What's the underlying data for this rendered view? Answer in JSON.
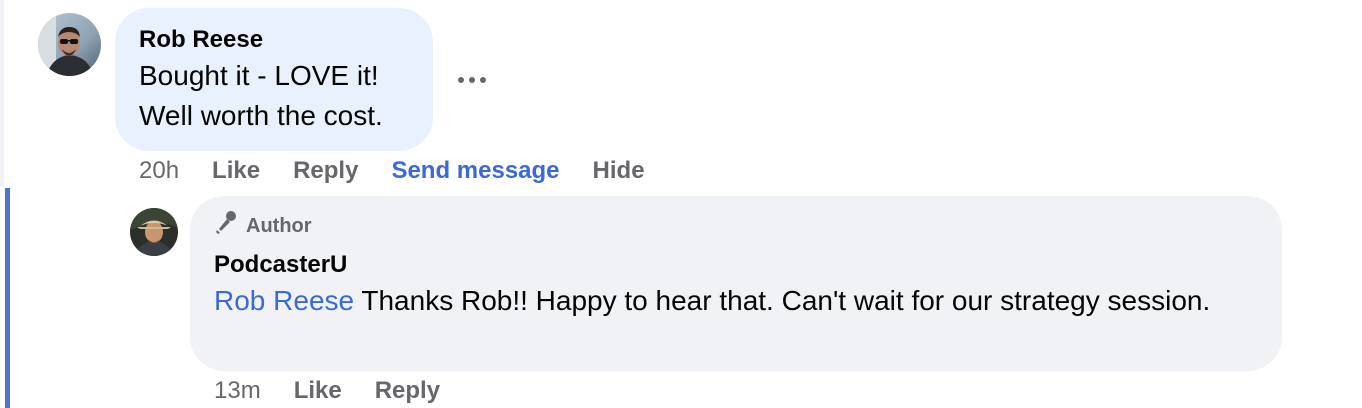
{
  "comment": {
    "author": "Rob Reese",
    "text_line1": "Bought it - LOVE it!",
    "text_line2": "Well worth the cost.",
    "timestamp": "20h",
    "actions": {
      "like": "Like",
      "reply": "Reply",
      "send_message": "Send message",
      "hide": "Hide"
    },
    "more_icon": "more-options-icon"
  },
  "reply": {
    "badge_icon": "microphone-icon",
    "badge_label": "Author",
    "author": "PodcasterU",
    "mention": "Rob Reese",
    "text": " Thanks Rob!! Happy to hear that. Can't wait for our strategy session.",
    "timestamp": "13m",
    "actions": {
      "like": "Like",
      "reply": "Reply"
    }
  },
  "colors": {
    "comment_bubble": "#e8f1fd",
    "reply_bubble": "#f0f2f5",
    "link_blue": "#3b6ad8",
    "thread_line": "#4b74d6",
    "muted_text": "#65676b"
  }
}
